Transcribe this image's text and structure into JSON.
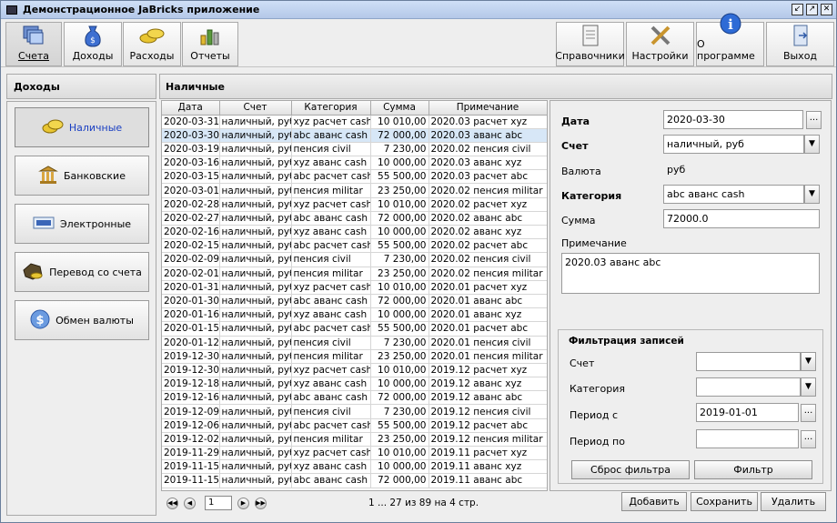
{
  "window": {
    "title": "Демонстрационное JaBricks приложение"
  },
  "toolbar": {
    "left": [
      {
        "label": "Счета",
        "icon": "accounts-icon"
      },
      {
        "label": "Доходы",
        "icon": "income-money-bag-icon"
      },
      {
        "label": "Расходы",
        "icon": "expenses-coins-icon"
      },
      {
        "label": "Отчеты",
        "icon": "reports-chart-icon"
      }
    ],
    "right": [
      {
        "label": "Справочники",
        "icon": "references-icon"
      },
      {
        "label": "Настройки",
        "icon": "settings-tools-icon"
      },
      {
        "label": "О программе",
        "icon": "info-icon"
      },
      {
        "label": "Выход",
        "icon": "exit-door-icon"
      }
    ]
  },
  "left_panel": {
    "title": "Доходы",
    "items": [
      {
        "label": "Наличные",
        "icon": "cash-coins-icon"
      },
      {
        "label": "Банковские",
        "icon": "bank-icon"
      },
      {
        "label": "Электронные",
        "icon": "paypal-card-icon"
      },
      {
        "label": "Перевод со счета",
        "icon": "transfer-icon"
      },
      {
        "label": "Обмен валюты",
        "icon": "currency-exchange-icon"
      }
    ]
  },
  "main": {
    "title": "Наличные",
    "table": {
      "columns": [
        "Дата",
        "Счет",
        "Категория",
        "Сумма",
        "Примечание"
      ],
      "rows": [
        [
          "2020-03-31",
          "наличный, руб",
          "xyz расчет cash",
          "10 010,00",
          "2020.03 расчет xyz"
        ],
        [
          "2020-03-30",
          "наличный, руб",
          "abc аванс cash",
          "72 000,00",
          "2020.03 аванс abc"
        ],
        [
          "2020-03-19",
          "наличный, руб",
          "пенсия civil",
          "7 230,00",
          "2020.02 пенсия civil"
        ],
        [
          "2020-03-16",
          "наличный, руб",
          "xyz аванс cash",
          "10 000,00",
          "2020.03 аванс xyz"
        ],
        [
          "2020-03-15",
          "наличный, руб",
          "abc расчет cash",
          "55 500,00",
          "2020.03 расчет abc"
        ],
        [
          "2020-03-01",
          "наличный, руб",
          "пенсия militar",
          "23 250,00",
          "2020.02 пенсия militar"
        ],
        [
          "2020-02-28",
          "наличный, руб",
          "xyz расчет cash",
          "10 010,00",
          "2020.02 расчет xyz"
        ],
        [
          "2020-02-27",
          "наличный, руб",
          "abc аванс cash",
          "72 000,00",
          "2020.02 аванс abc"
        ],
        [
          "2020-02-16",
          "наличный, руб",
          "xyz аванс cash",
          "10 000,00",
          "2020.02 аванс xyz"
        ],
        [
          "2020-02-15",
          "наличный, руб",
          "abc расчет cash",
          "55 500,00",
          "2020.02 расчет abc"
        ],
        [
          "2020-02-09",
          "наличный, руб",
          "пенсия civil",
          "7 230,00",
          "2020.02 пенсия civil"
        ],
        [
          "2020-02-01",
          "наличный, руб",
          "пенсия militar",
          "23 250,00",
          "2020.02 пенсия militar"
        ],
        [
          "2020-01-31",
          "наличный, руб",
          "xyz расчет cash",
          "10 010,00",
          "2020.01 расчет xyz"
        ],
        [
          "2020-01-30",
          "наличный, руб",
          "abc аванс cash",
          "72 000,00",
          "2020.01 аванс abc"
        ],
        [
          "2020-01-16",
          "наличный, руб",
          "xyz аванс cash",
          "10 000,00",
          "2020.01 аванс xyz"
        ],
        [
          "2020-01-15",
          "наличный, руб",
          "abc расчет cash",
          "55 500,00",
          "2020.01 расчет abc"
        ],
        [
          "2020-01-12",
          "наличный, руб",
          "пенсия civil",
          "7 230,00",
          "2020.01 пенсия civil"
        ],
        [
          "2019-12-30",
          "наличный, руб",
          "пенсия militar",
          "23 250,00",
          "2020.01 пенсия militar"
        ],
        [
          "2019-12-30",
          "наличный, руб",
          "xyz расчет cash",
          "10 010,00",
          "2019.12 расчет xyz"
        ],
        [
          "2019-12-18",
          "наличный, руб",
          "xyz аванс cash",
          "10 000,00",
          "2019.12 аванс xyz"
        ],
        [
          "2019-12-16",
          "наличный, руб",
          "abc аванс cash",
          "72 000,00",
          "2019.12 аванс abc"
        ],
        [
          "2019-12-09",
          "наличный, руб",
          "пенсия civil",
          "7 230,00",
          "2019.12 пенсия civil"
        ],
        [
          "2019-12-06",
          "наличный, руб",
          "abc расчет cash",
          "55 500,00",
          "2019.12 расчет abc"
        ],
        [
          "2019-12-02",
          "наличный, руб",
          "пенсия militar",
          "23 250,00",
          "2019.12 пенсия militar"
        ],
        [
          "2019-11-29",
          "наличный, руб",
          "xyz расчет cash",
          "10 010,00",
          "2019.11 расчет xyz"
        ],
        [
          "2019-11-15",
          "наличный, руб",
          "xyz аванс cash",
          "10 000,00",
          "2019.11 аванс xyz"
        ],
        [
          "2019-11-15",
          "наличный, руб",
          "abc аванс cash",
          "72 000,00",
          "2019.11 аванс abc"
        ]
      ],
      "selected_row": 1
    },
    "pager": {
      "page": "1",
      "info": "1 ... 27 из 89 на 4 стр."
    }
  },
  "form": {
    "date_label": "Дата",
    "date_value": "2020-03-30",
    "dots": "...",
    "account_label": "Счет",
    "account_value": "наличный, руб",
    "currency_label": "Валюта",
    "currency_value": "руб",
    "category_label": "Категория",
    "category_value": "abc аванс cash",
    "amount_label": "Сумма",
    "amount_value": "72000.0",
    "note_label": "Примечание",
    "note_value": "2020.03 аванс abc"
  },
  "filter": {
    "title": "Фильтрация записей",
    "account_label": "Счет",
    "category_label": "Категория",
    "period_from_label": "Период с",
    "period_from_value": "2019-01-01",
    "period_to_label": "Период по",
    "period_to_value": "",
    "reset_label": "Сброс фильтра",
    "apply_label": "Фильтр"
  },
  "actions": {
    "add_label": "Добавить",
    "save_label": "Сохранить",
    "delete_label": "Удалить"
  },
  "colors": {
    "selection": "#d7e7f7",
    "title_bar": "#c4d6f0",
    "link_blue": "#1a3fc2"
  }
}
